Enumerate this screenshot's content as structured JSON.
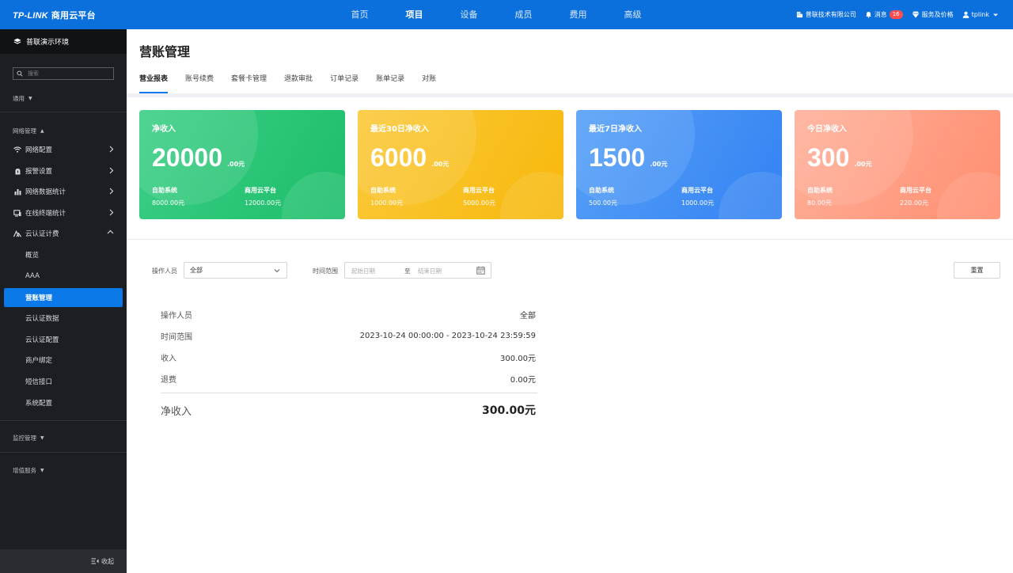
{
  "topbar": {
    "logo_brand": "TP-LINK",
    "logo_product": "商用云平台",
    "nav": [
      {
        "label": "首页",
        "active": false
      },
      {
        "label": "项目",
        "active": true
      },
      {
        "label": "设备",
        "active": false
      },
      {
        "label": "成员",
        "active": false
      },
      {
        "label": "费用",
        "active": false
      },
      {
        "label": "高级",
        "active": false
      }
    ],
    "company": "普联技术有限公司",
    "messages_label": "消息",
    "messages_count": "16",
    "service_label": "服务及价格",
    "user": "tplink"
  },
  "sidebar": {
    "environment": "普联演示环境",
    "search_placeholder": "搜索",
    "group_general": "通用",
    "group_network": "网络管理",
    "network_items": [
      {
        "label": "网络配置",
        "icon": "wifi-icon"
      },
      {
        "label": "报警设置",
        "icon": "alarm-icon"
      },
      {
        "label": "网络数据统计",
        "icon": "bar-chart-icon"
      },
      {
        "label": "在线终端统计",
        "icon": "monitor-icon"
      },
      {
        "label": "云认证计费",
        "icon": "cloud-auth-icon"
      }
    ],
    "cloud_items": [
      {
        "label": "概览"
      },
      {
        "label": "AAA"
      },
      {
        "label": "营账管理",
        "active": true
      },
      {
        "label": "云认证数据"
      },
      {
        "label": "云认证配置"
      },
      {
        "label": "商户绑定"
      },
      {
        "label": "短信接口"
      },
      {
        "label": "系统配置"
      }
    ],
    "group_monitor": "监控管理",
    "group_value_added": "增值服务",
    "collapse_label": "收起"
  },
  "main": {
    "title": "营账管理",
    "tabs": [
      {
        "label": "营业报表",
        "active": true
      },
      {
        "label": "账号续费"
      },
      {
        "label": "套餐卡管理"
      },
      {
        "label": "退款审批"
      },
      {
        "label": "订单记录"
      },
      {
        "label": "账单记录"
      },
      {
        "label": "对账"
      }
    ],
    "cards": [
      {
        "title": "净收入",
        "amount": "20000",
        "unit": ".00元",
        "left_label": "自助系统",
        "left_value": "8000.00元",
        "right_label": "商用云平台",
        "right_value": "12000.00元",
        "color": "#22c06f"
      },
      {
        "title": "最近30日净收入",
        "amount": "6000",
        "unit": ".00元",
        "left_label": "自助系统",
        "left_value": "1000.00元",
        "right_label": "商用云平台",
        "right_value": "5000.00元",
        "color": "#f9bd1d"
      },
      {
        "title": "最近7日净收入",
        "amount": "1500",
        "unit": ".00元",
        "left_label": "自助系统",
        "left_value": "500.00元",
        "right_label": "商用云平台",
        "right_value": "1000.00元",
        "color": "#3f8cf5"
      },
      {
        "title": "今日净收入",
        "amount": "300",
        "unit": ".00元",
        "left_label": "自助系统",
        "left_value": "80.00元",
        "right_label": "商用云平台",
        "right_value": "220.00元",
        "color": "#ff9a7e"
      }
    ],
    "filters": {
      "operator_label": "操作人员",
      "operator_value": "全部",
      "time_label": "时间范围",
      "start_placeholder": "起始日期",
      "to_label": "至",
      "end_placeholder": "结束日期",
      "reset_label": "重置"
    },
    "summary": [
      {
        "label": "操作人员",
        "value": "全部"
      },
      {
        "label": "时间范围",
        "value": "2023-10-24 00:00:00 - 2023-10-24 23:59:59"
      },
      {
        "label": "收入",
        "value": "300.00元"
      },
      {
        "label": "退费",
        "value": "0.00元"
      }
    ],
    "net_label": "净收入",
    "net_value": "300.00元"
  }
}
